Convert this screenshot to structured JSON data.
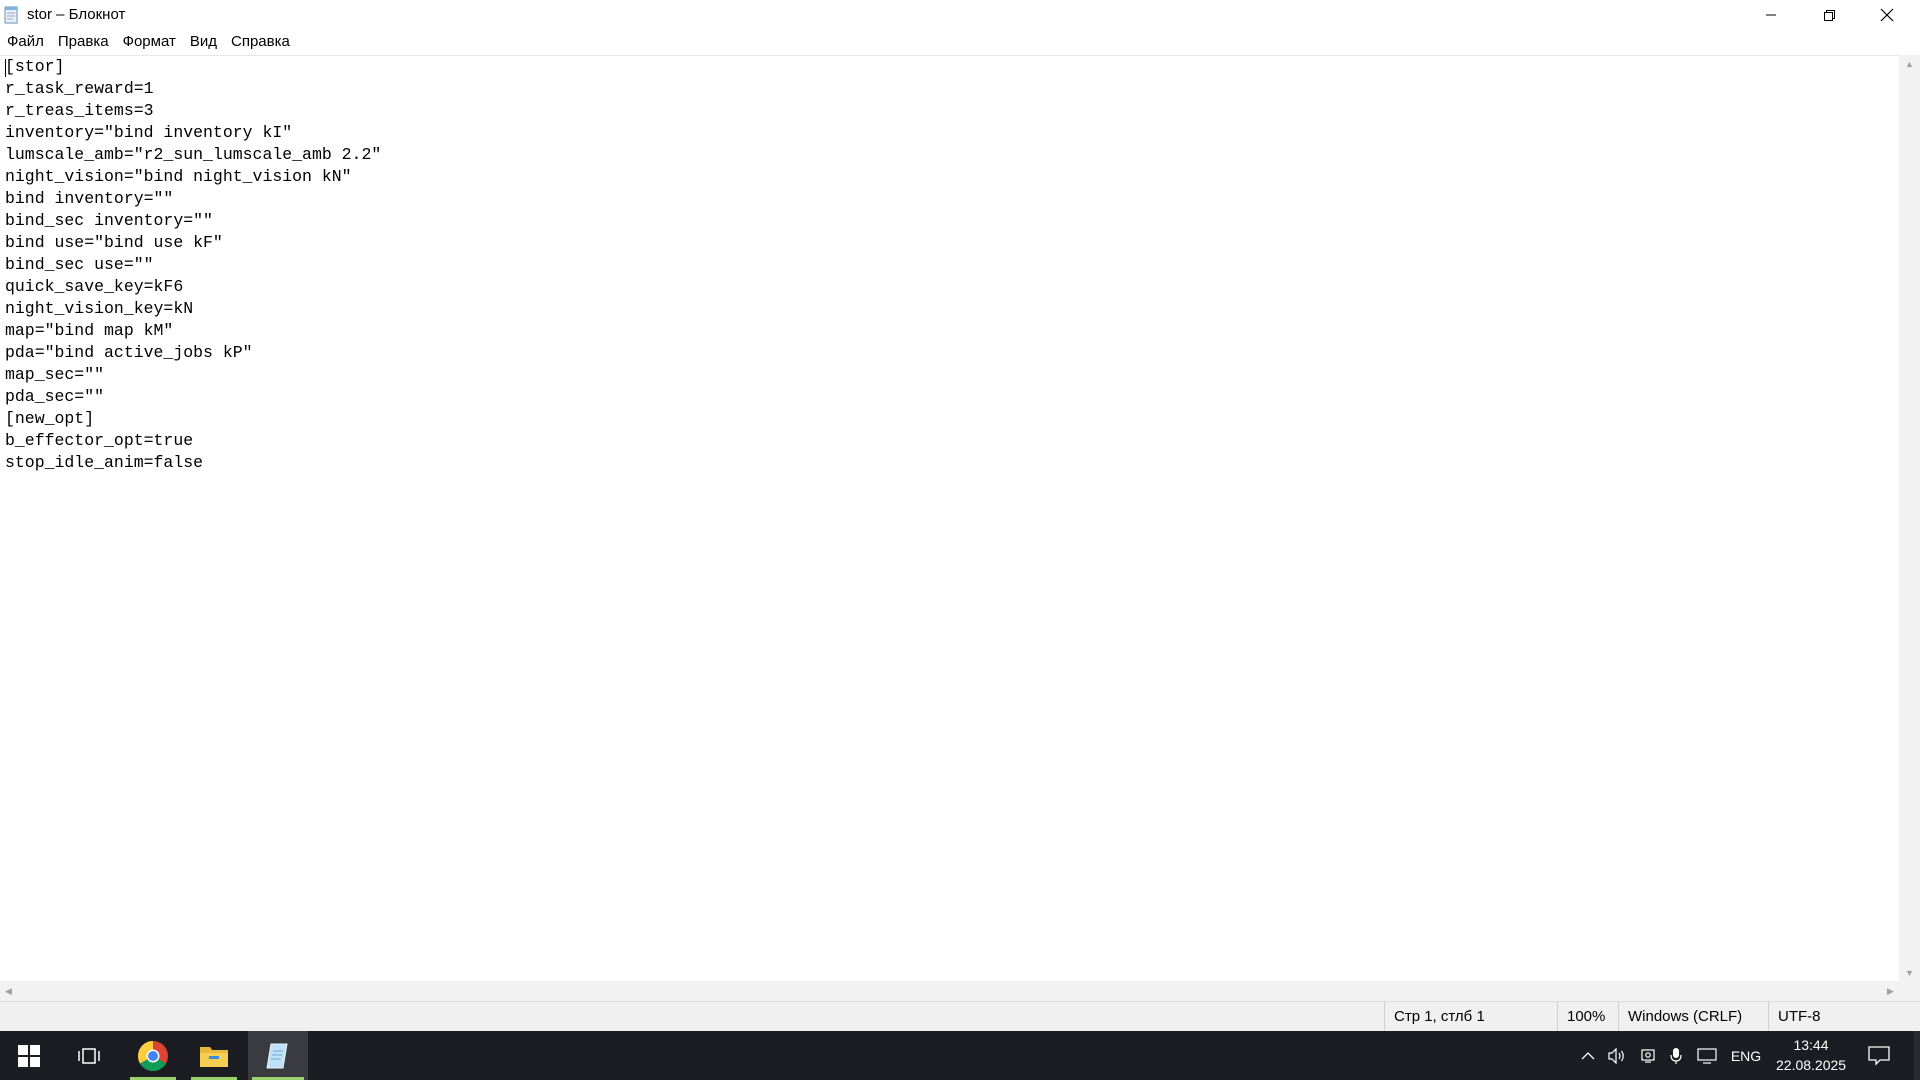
{
  "window": {
    "title": "stor – Блокнот"
  },
  "menu": [
    "Файл",
    "Правка",
    "Формат",
    "Вид",
    "Справка"
  ],
  "editor": {
    "lines": [
      "[stor]",
      "r_task_reward=1",
      "r_treas_items=3",
      "inventory=\"bind inventory kI\"",
      "lumscale_amb=\"r2_sun_lumscale_amb 2.2\"",
      "night_vision=\"bind night_vision kN\"",
      "bind inventory=\"\"",
      "bind_sec inventory=\"\"",
      "bind use=\"bind use kF\"",
      "bind_sec use=\"\"",
      "quick_save_key=kF6",
      "night_vision_key=kN",
      "map=\"bind map kM\"",
      "pda=\"bind active_jobs kP\"",
      "map_sec=\"\"",
      "pda_sec=\"\"",
      "[new_opt]",
      "b_effector_opt=true",
      "stop_idle_anim=false"
    ]
  },
  "status": {
    "position": "Стр 1, стлб 1",
    "zoom": "100%",
    "line_ending": "Windows (CRLF)",
    "encoding": "UTF-8"
  },
  "taskbar": {
    "language": "ENG",
    "time": "13:44",
    "date": "22.08.2025",
    "icons": [
      "start-icon",
      "task-view-icon",
      "chrome-icon",
      "file-explorer-icon",
      "notepad-icon"
    ]
  }
}
